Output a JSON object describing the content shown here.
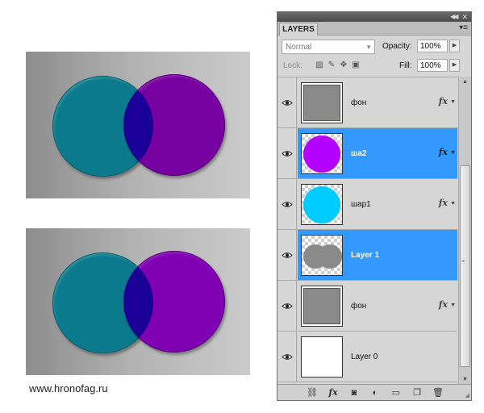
{
  "watermark": "www.hronofag.ru",
  "panel": {
    "tab_label": "LAYERS",
    "blend_mode": "Normal",
    "opacity_label": "Opacity:",
    "opacity_value": "100%",
    "lock_label": "Lock:",
    "fill_label": "Fill:",
    "fill_value": "100%"
  },
  "layers": [
    {
      "name": "фон",
      "selected": false,
      "thumb": "gray",
      "fx": true
    },
    {
      "name": "ша2",
      "selected": true,
      "thumb": "purple-circle",
      "fx": true
    },
    {
      "name": "шар1",
      "selected": false,
      "thumb": "cyan-circle",
      "fx": true
    },
    {
      "name": "Layer 1",
      "selected": true,
      "thumb": "gray-double-circle",
      "fx": false
    },
    {
      "name": "фон",
      "selected": false,
      "thumb": "gray",
      "fx": true
    },
    {
      "name": "Layer 0",
      "selected": false,
      "thumb": "white",
      "fx": false
    }
  ],
  "fx_symbol": "fx",
  "colors": {
    "teal": "#0a7a8c",
    "purple": "#7600a0",
    "overlap": "#1a0096",
    "selection_blue": "#3399ff",
    "thumb_purple": "#b300ff",
    "thumb_cyan": "#00ccff",
    "thumb_gray": "#8a8a8a"
  },
  "icons": {
    "bottom_bar": [
      "link-icon",
      "fx-icon",
      "mask-icon",
      "adjustment-icon",
      "group-folder-icon",
      "new-layer-icon",
      "trash-icon"
    ]
  }
}
